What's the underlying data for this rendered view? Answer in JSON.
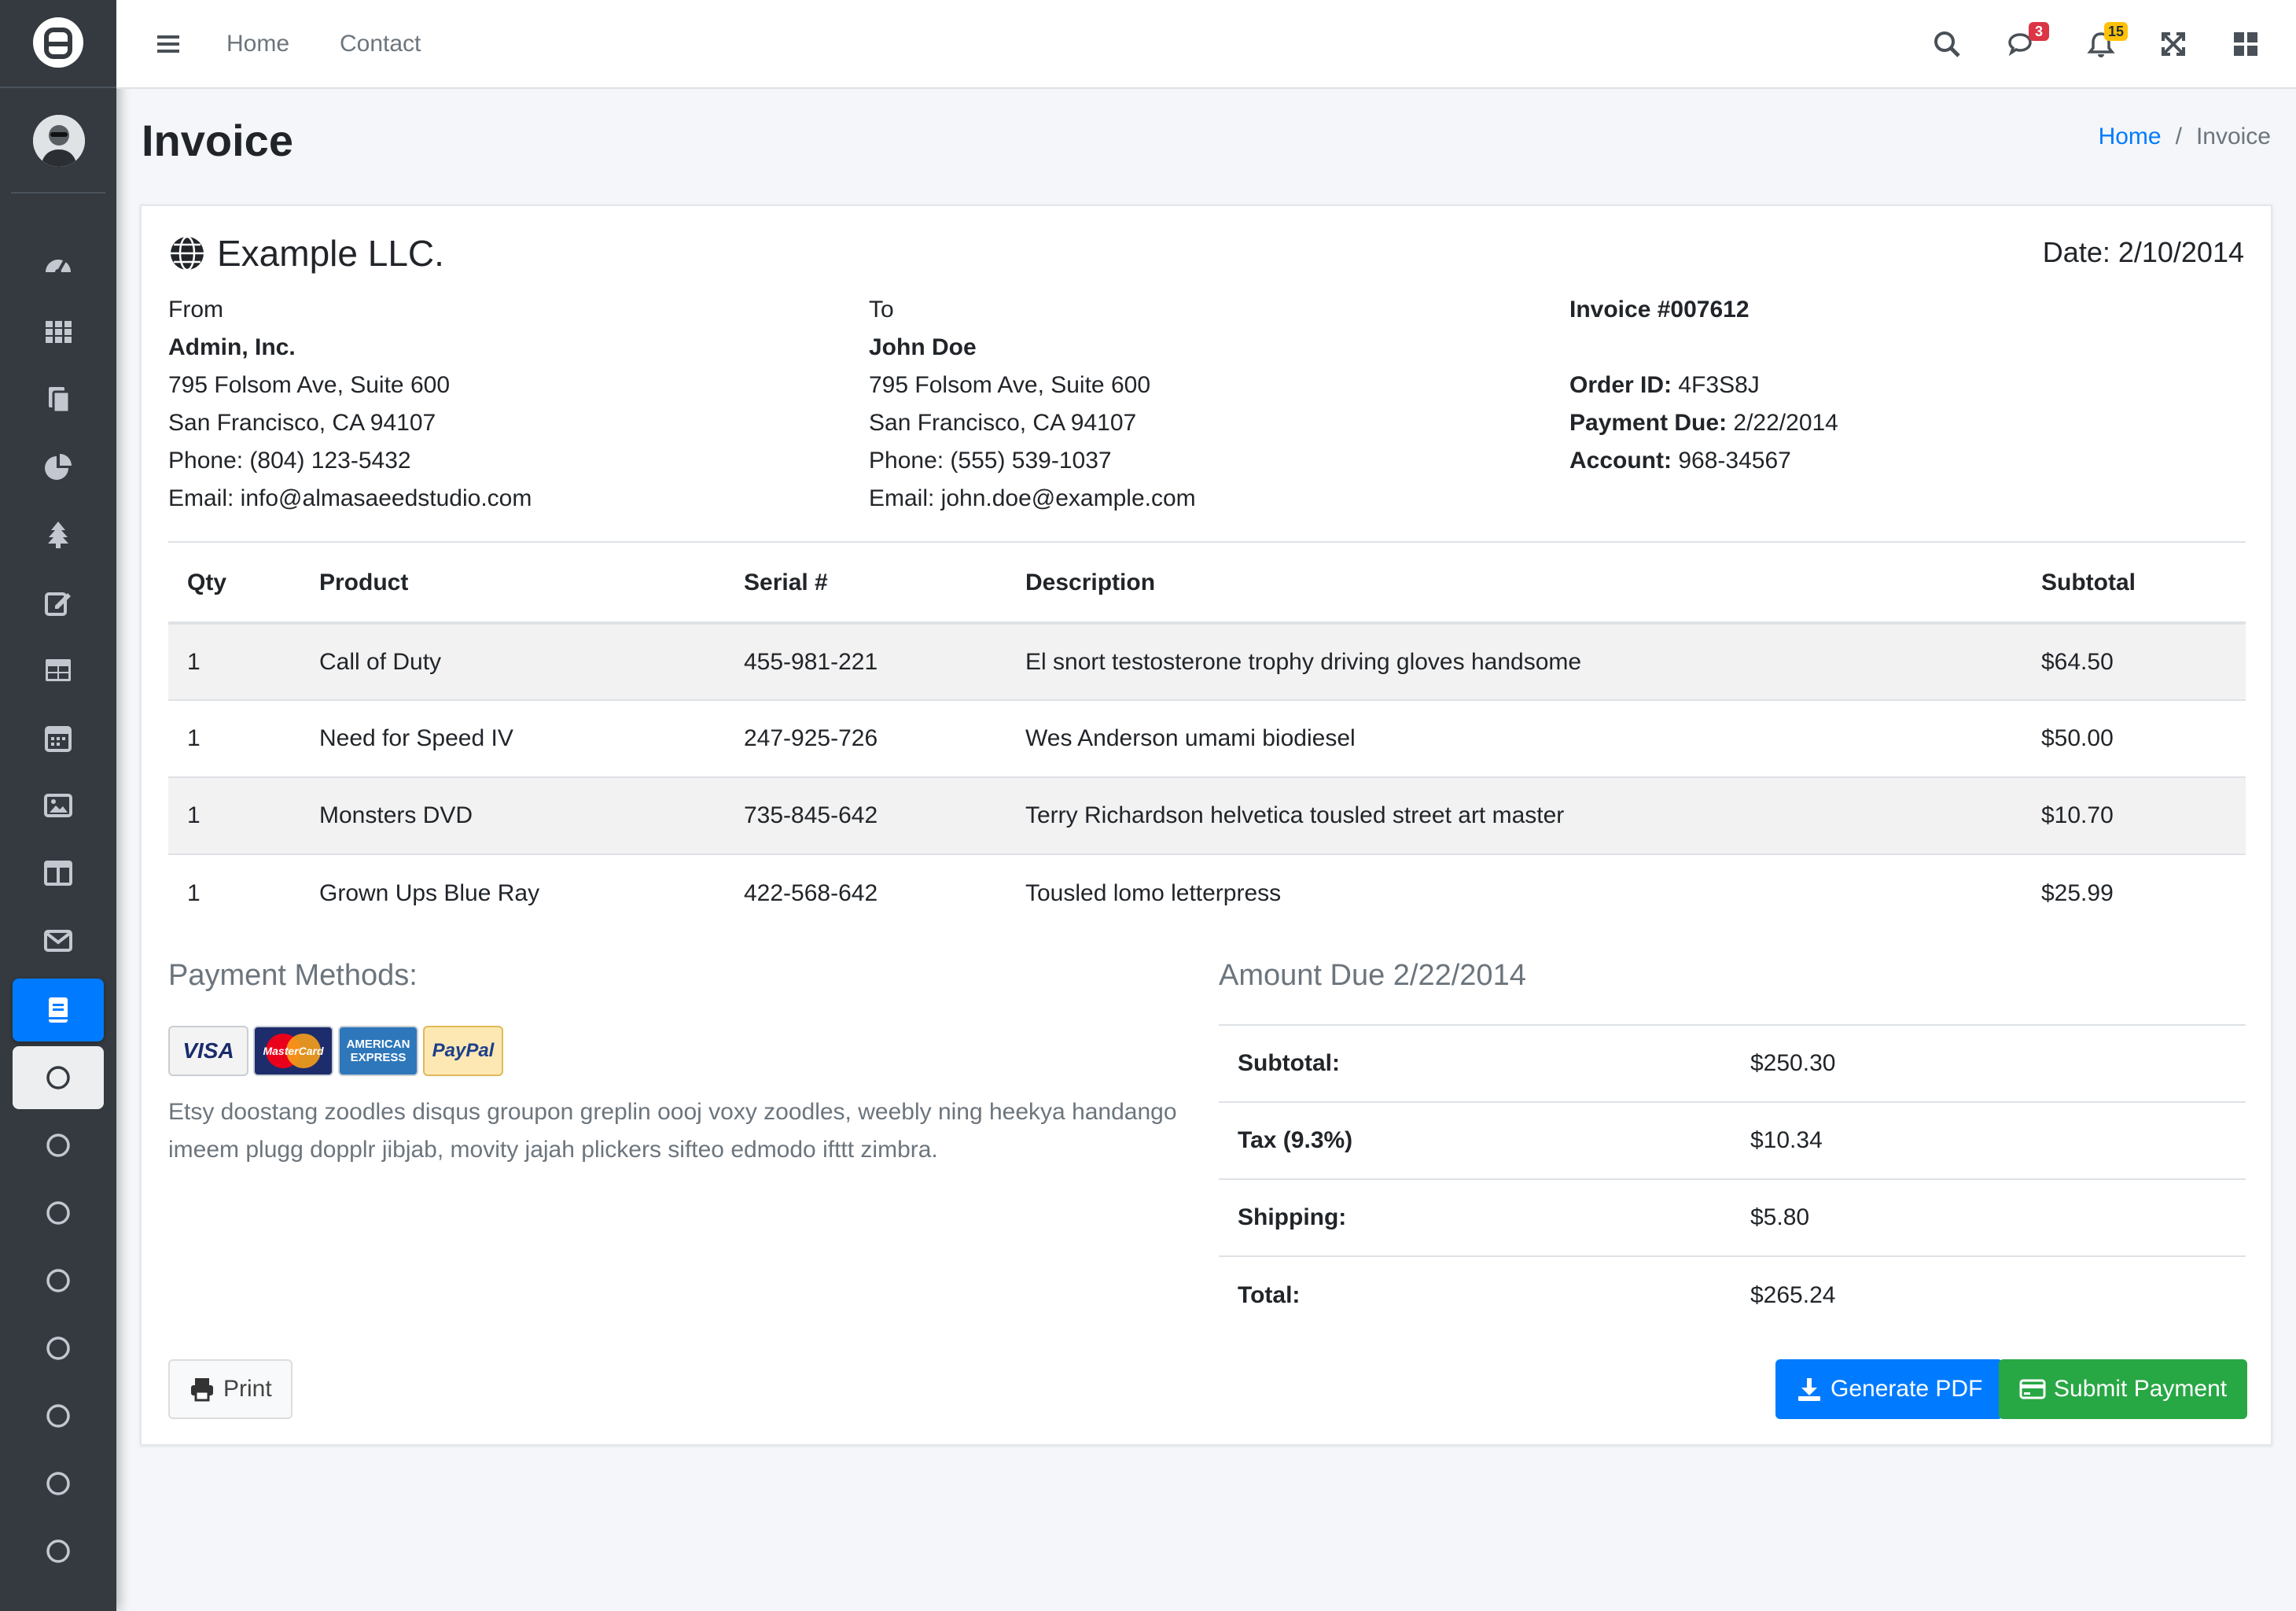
{
  "topbar": {
    "nav": [
      "Home",
      "Contact"
    ],
    "messages_count": "3",
    "notifications_count": "15"
  },
  "page": {
    "title": "Invoice",
    "breadcrumb": [
      "Home",
      "/",
      "Invoice"
    ]
  },
  "invoice": {
    "company": "Example LLC.",
    "date": "Date: 2/10/2014",
    "from": {
      "label": "From",
      "name": "Admin, Inc.",
      "address1": "795 Folsom Ave, Suite 600",
      "address2": "San Francisco, CA 94107",
      "phone": "Phone: (804) 123-5432",
      "email": "Email: info@almasaeedstudio.com"
    },
    "to": {
      "label": "To",
      "name": "John Doe",
      "address1": "795 Folsom Ave, Suite 600",
      "address2": "San Francisco, CA 94107",
      "phone": "Phone: (555) 539-1037",
      "email": "Email: john.doe@example.com"
    },
    "meta": {
      "invoice_no": "Invoice #007612",
      "order_label": "Order ID:",
      "order_value": "4F3S8J",
      "due_label": "Payment Due:",
      "due_value": "2/22/2014",
      "account_label": "Account:",
      "account_value": "968-34567"
    },
    "columns": [
      "Qty",
      "Product",
      "Serial #",
      "Description",
      "Subtotal"
    ],
    "rows": [
      [
        "1",
        "Call of Duty",
        "455-981-221",
        "El snort testosterone trophy driving gloves handsome",
        "$64.50"
      ],
      [
        "1",
        "Need for Speed IV",
        "247-925-726",
        "Wes Anderson umami biodiesel",
        "$50.00"
      ],
      [
        "1",
        "Monsters DVD",
        "735-845-642",
        "Terry Richardson helvetica tousled street art master",
        "$10.70"
      ],
      [
        "1",
        "Grown Ups Blue Ray",
        "422-568-642",
        "Tousled lomo letterpress",
        "$25.99"
      ]
    ],
    "payment": {
      "title": "Payment Methods:",
      "cards": [
        "VISA",
        "MasterCard",
        "AMERICAN EXPRESS",
        "PayPal"
      ],
      "note": "Etsy doostang zoodles disqus groupon greplin oooj voxy zoodles, weebly ning heekya handango imeem plugg dopplr jibjab, movity jajah plickers sifteo edmodo ifttt zimbra."
    },
    "amount_due": {
      "title": "Amount Due 2/22/2014",
      "subtotal_label": "Subtotal:",
      "subtotal": "$250.30",
      "tax_label": "Tax (9.3%)",
      "tax": "$10.34",
      "shipping_label": "Shipping:",
      "shipping": "$5.80",
      "total_label": "Total:",
      "total": "$265.24"
    },
    "buttons": {
      "print": "Print",
      "pdf": "Generate PDF",
      "pay": "Submit Payment"
    }
  },
  "colors": {
    "primary": "#007bff",
    "success": "#28a745",
    "sidebar": "#343a40",
    "badge_danger": "#dc3545",
    "badge_warning": "#ffc107"
  }
}
